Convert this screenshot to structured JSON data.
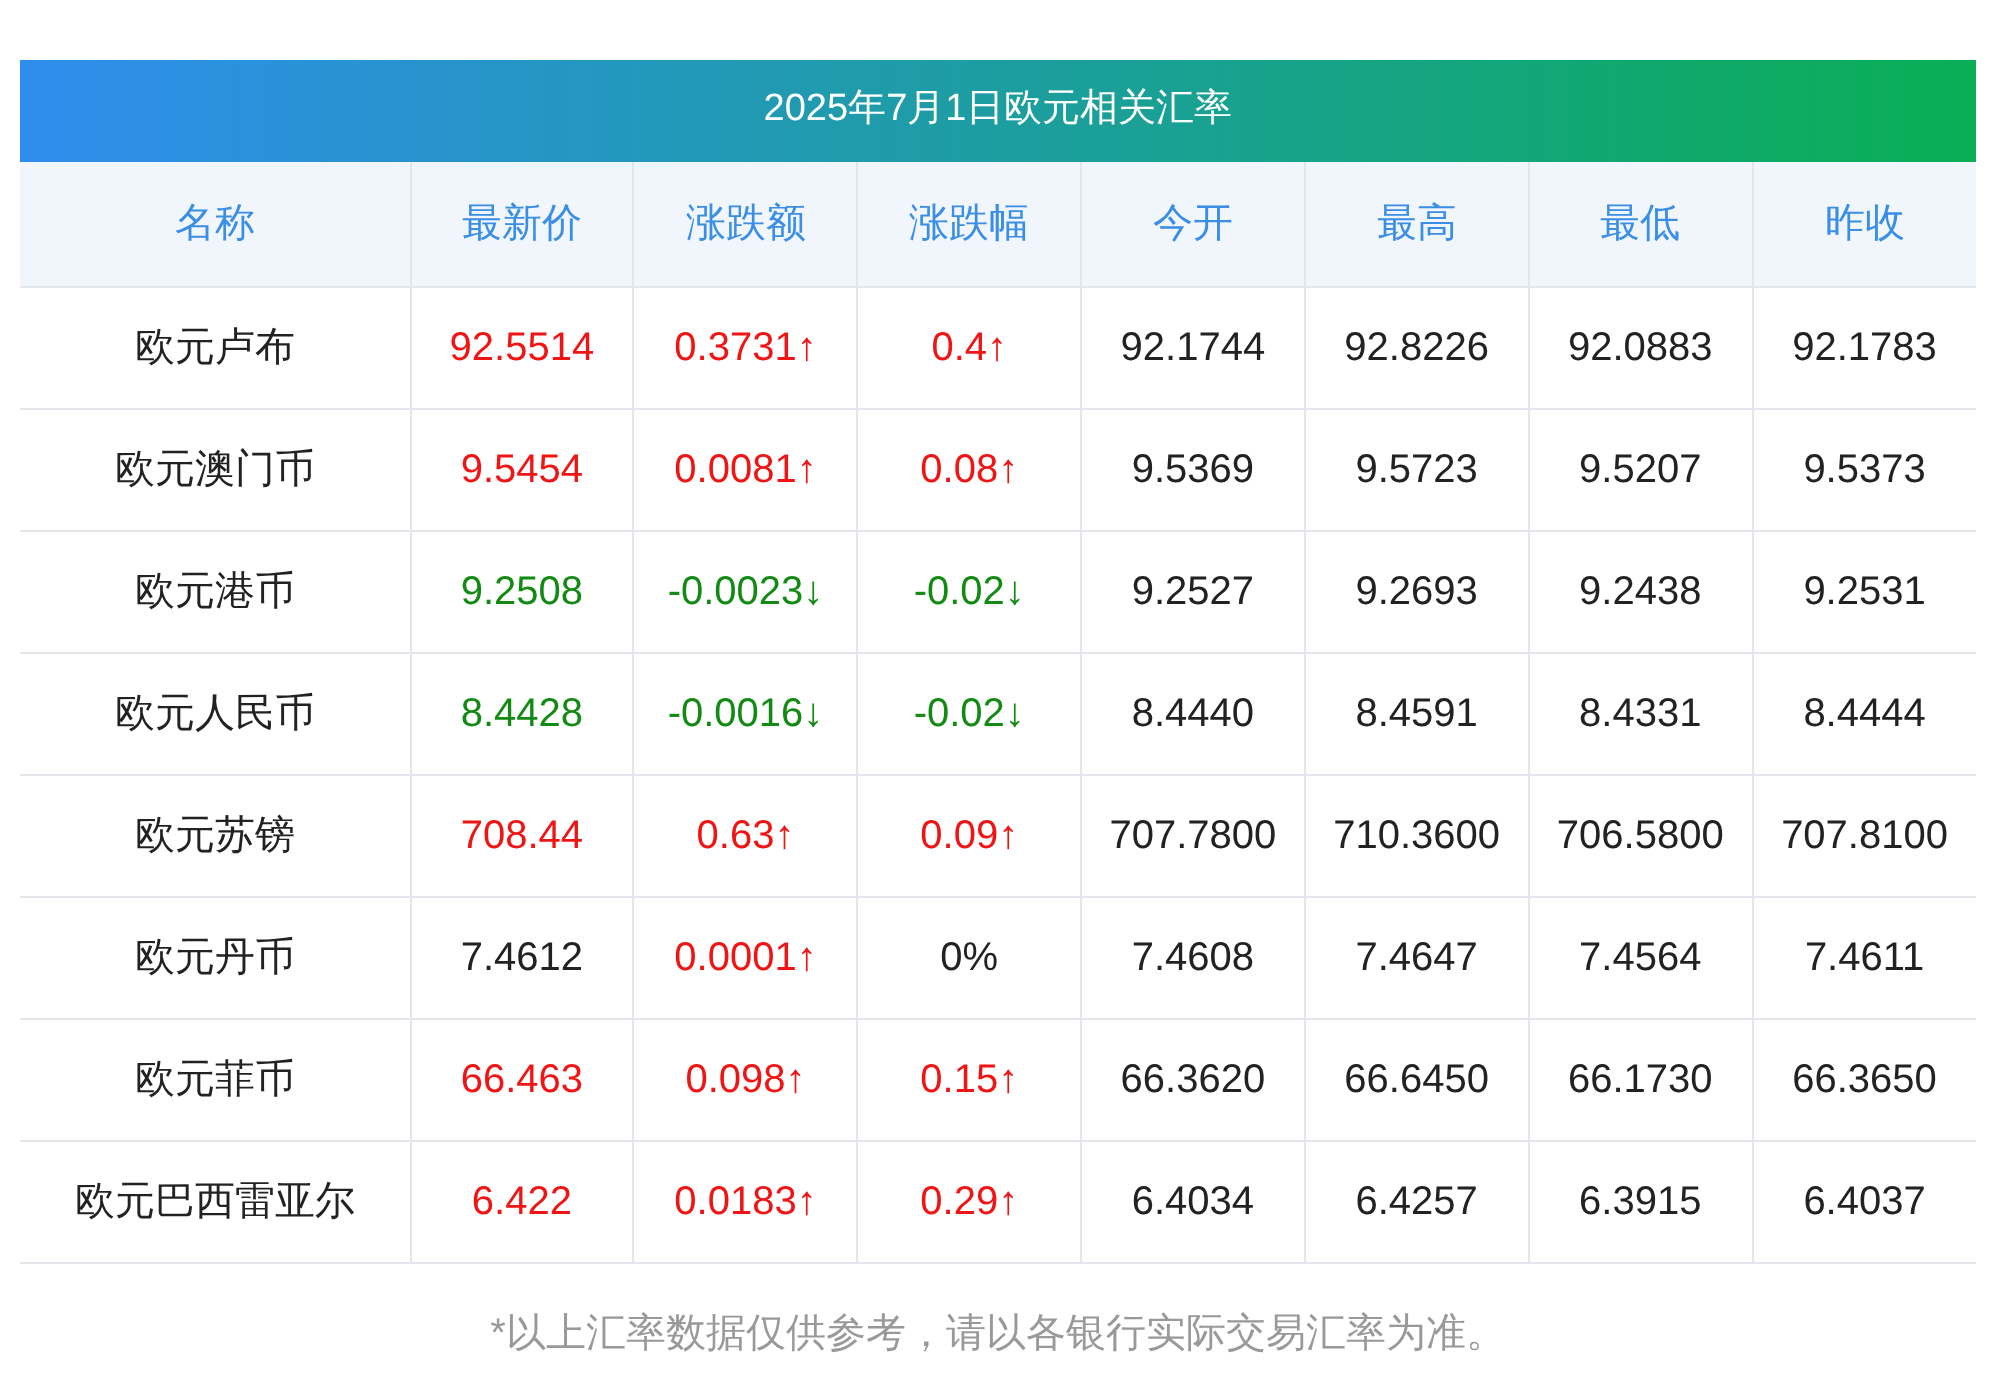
{
  "title": "2025年7月1日欧元相关汇率",
  "columns": [
    "名称",
    "最新价",
    "涨跌额",
    "涨跌幅",
    "今开",
    "最高",
    "最低",
    "昨收"
  ],
  "rows": [
    {
      "name": "欧元卢布",
      "price": {
        "text": "92.5514",
        "color": "#f01414"
      },
      "change": {
        "text": "0.3731↑",
        "color": "#f01414"
      },
      "percent": {
        "text": "0.4↑",
        "color": "#f01414"
      },
      "open": "92.1744",
      "high": "92.8226",
      "low": "92.0883",
      "prev": "92.1783"
    },
    {
      "name": "欧元澳门币",
      "price": {
        "text": "9.5454",
        "color": "#f01414"
      },
      "change": {
        "text": "0.0081↑",
        "color": "#f01414"
      },
      "percent": {
        "text": "0.08↑",
        "color": "#f01414"
      },
      "open": "9.5369",
      "high": "9.5723",
      "low": "9.5207",
      "prev": "9.5373"
    },
    {
      "name": "欧元港币",
      "price": {
        "text": "9.2508",
        "color": "#138a13"
      },
      "change": {
        "text": "-0.0023↓",
        "color": "#138a13"
      },
      "percent": {
        "text": "-0.02↓",
        "color": "#138a13"
      },
      "open": "9.2527",
      "high": "9.2693",
      "low": "9.2438",
      "prev": "9.2531"
    },
    {
      "name": "欧元人民币",
      "price": {
        "text": "8.4428",
        "color": "#138a13"
      },
      "change": {
        "text": "-0.0016↓",
        "color": "#138a13"
      },
      "percent": {
        "text": "-0.02↓",
        "color": "#138a13"
      },
      "open": "8.4440",
      "high": "8.4591",
      "low": "8.4331",
      "prev": "8.4444"
    },
    {
      "name": "欧元苏镑",
      "price": {
        "text": "708.44",
        "color": "#f01414"
      },
      "change": {
        "text": "0.63↑",
        "color": "#f01414"
      },
      "percent": {
        "text": "0.09↑",
        "color": "#f01414"
      },
      "open": "707.7800",
      "high": "710.3600",
      "low": "706.5800",
      "prev": "707.8100"
    },
    {
      "name": "欧元丹币",
      "price": {
        "text": "7.4612",
        "color": "#222222"
      },
      "change": {
        "text": "0.0001↑",
        "color": "#f01414"
      },
      "percent": {
        "text": "0%",
        "color": "#222222"
      },
      "open": "7.4608",
      "high": "7.4647",
      "low": "7.4564",
      "prev": "7.4611"
    },
    {
      "name": "欧元菲币",
      "price": {
        "text": "66.463",
        "color": "#f01414"
      },
      "change": {
        "text": "0.098↑",
        "color": "#f01414"
      },
      "percent": {
        "text": "0.15↑",
        "color": "#f01414"
      },
      "open": "66.3620",
      "high": "66.6450",
      "low": "66.1730",
      "prev": "66.3650"
    },
    {
      "name": "欧元巴西雷亚尔",
      "price": {
        "text": "6.422",
        "color": "#f01414"
      },
      "change": {
        "text": "0.0183↑",
        "color": "#f01414"
      },
      "percent": {
        "text": "0.29↑",
        "color": "#f01414"
      },
      "open": "6.4034",
      "high": "6.4257",
      "low": "6.3915",
      "prev": "6.4037"
    }
  ],
  "footnote": "*以上汇率数据仅供参考，请以各银行实际交易汇率为准。"
}
